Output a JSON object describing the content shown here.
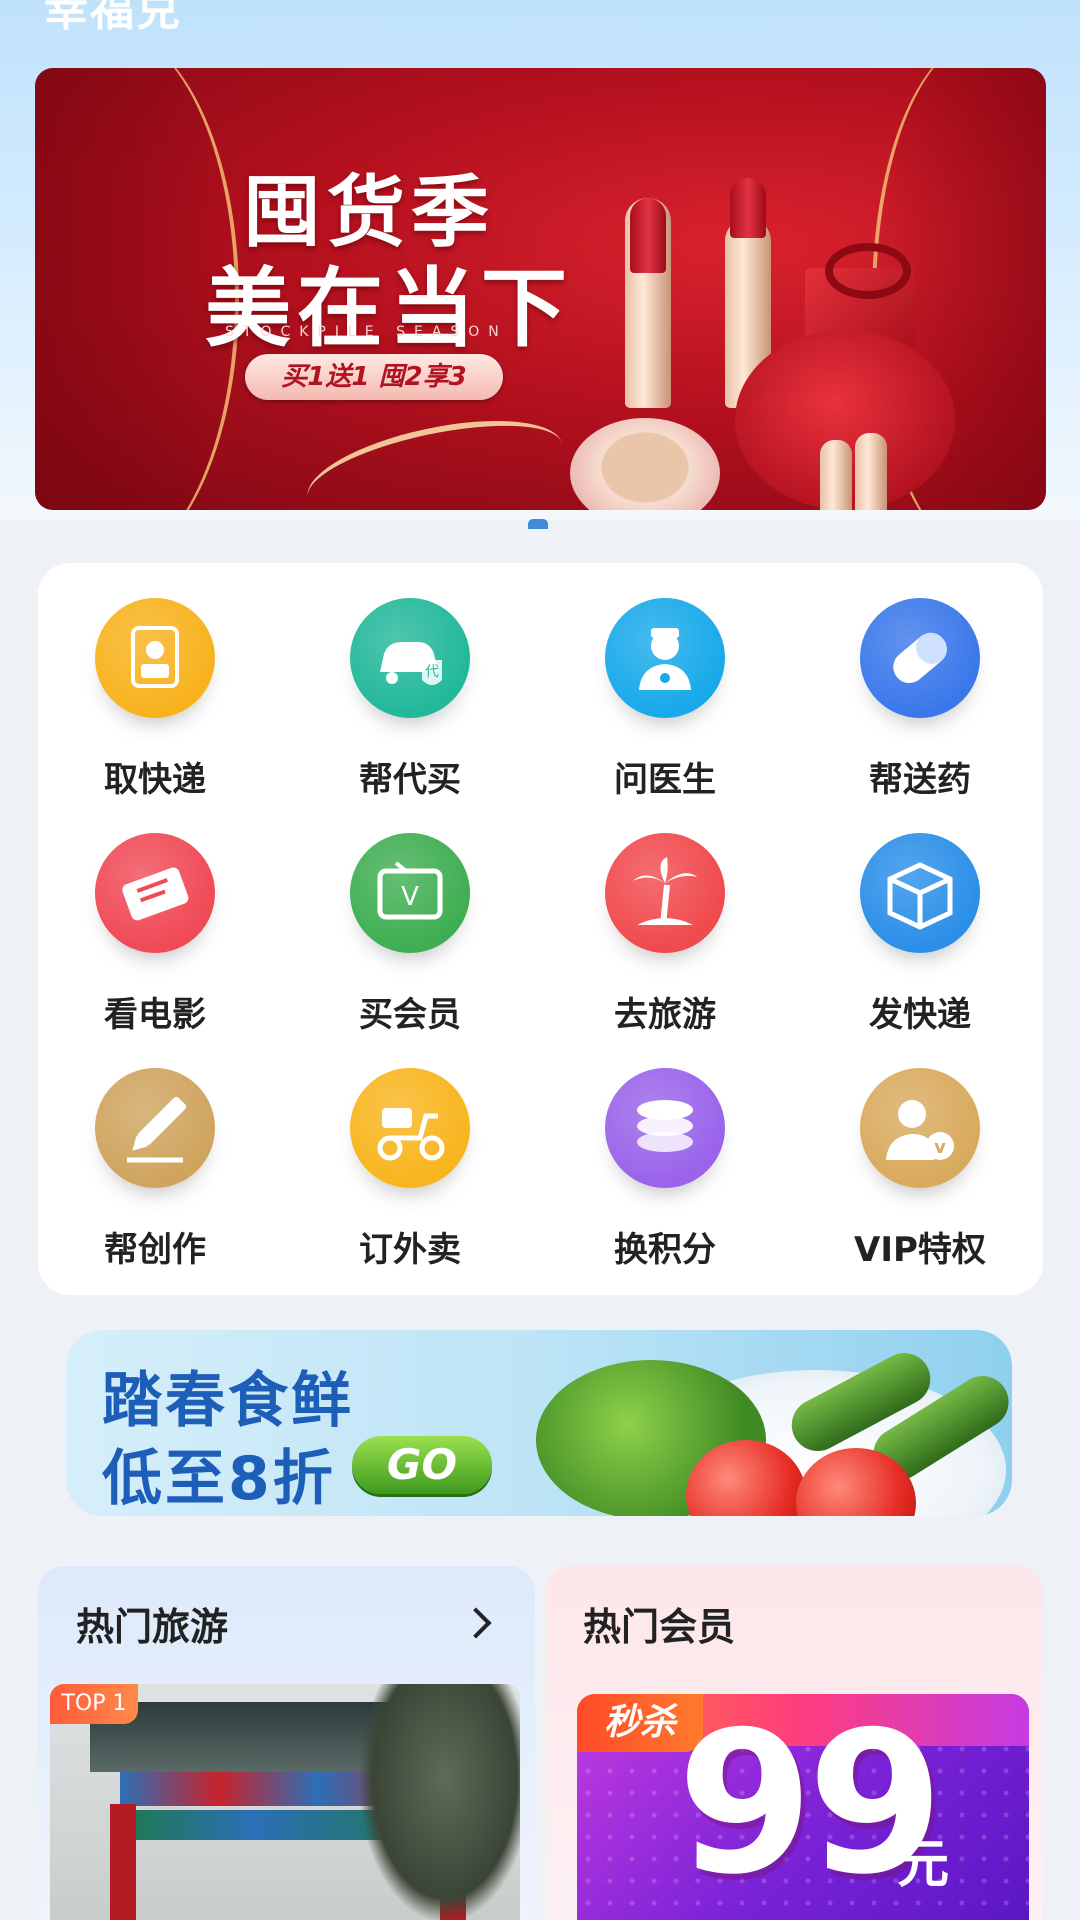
{
  "app": {
    "title": "幸福兑"
  },
  "banner": {
    "headline_1": "囤货季",
    "headline_2": "美在当下",
    "subtitle_en": "STOCKPILE SEASON",
    "offer": "买1送1 囤2享3"
  },
  "services": [
    {
      "label": "取快递",
      "icon": "courier-pickup-icon",
      "color": "#f8b21d"
    },
    {
      "label": "帮代买",
      "icon": "proxy-buy-icon",
      "color": "#22b89a"
    },
    {
      "label": "问医生",
      "icon": "doctor-icon",
      "color": "#18a9ea"
    },
    {
      "label": "帮送药",
      "icon": "pill-icon",
      "color": "#3a78ea"
    },
    {
      "label": "看电影",
      "icon": "ticket-icon",
      "color": "#f04a56"
    },
    {
      "label": "买会员",
      "icon": "tv-vip-icon",
      "color": "#3fae52"
    },
    {
      "label": "去旅游",
      "icon": "palm-tree-icon",
      "color": "#f04a4d"
    },
    {
      "label": "发快递",
      "icon": "package-box-icon",
      "color": "#2b8fe8"
    },
    {
      "label": "帮创作",
      "icon": "pencil-icon",
      "color": "#cfa45e"
    },
    {
      "label": "订外卖",
      "icon": "scooter-icon",
      "color": "#f8b51e"
    },
    {
      "label": "换积分",
      "icon": "coins-icon",
      "color": "#9a63ea"
    },
    {
      "label": "VIP特权",
      "icon": "vip-user-icon",
      "color": "#d9aa5e"
    }
  ],
  "promo": {
    "line_1": "踏春食鲜",
    "line_2": "低至8折",
    "button": "GO"
  },
  "hot_travel": {
    "title": "热门旅游",
    "badge": "TOP 1"
  },
  "hot_member": {
    "title": "热门会员",
    "badge": "秒杀",
    "price": "99",
    "unit": "元"
  }
}
